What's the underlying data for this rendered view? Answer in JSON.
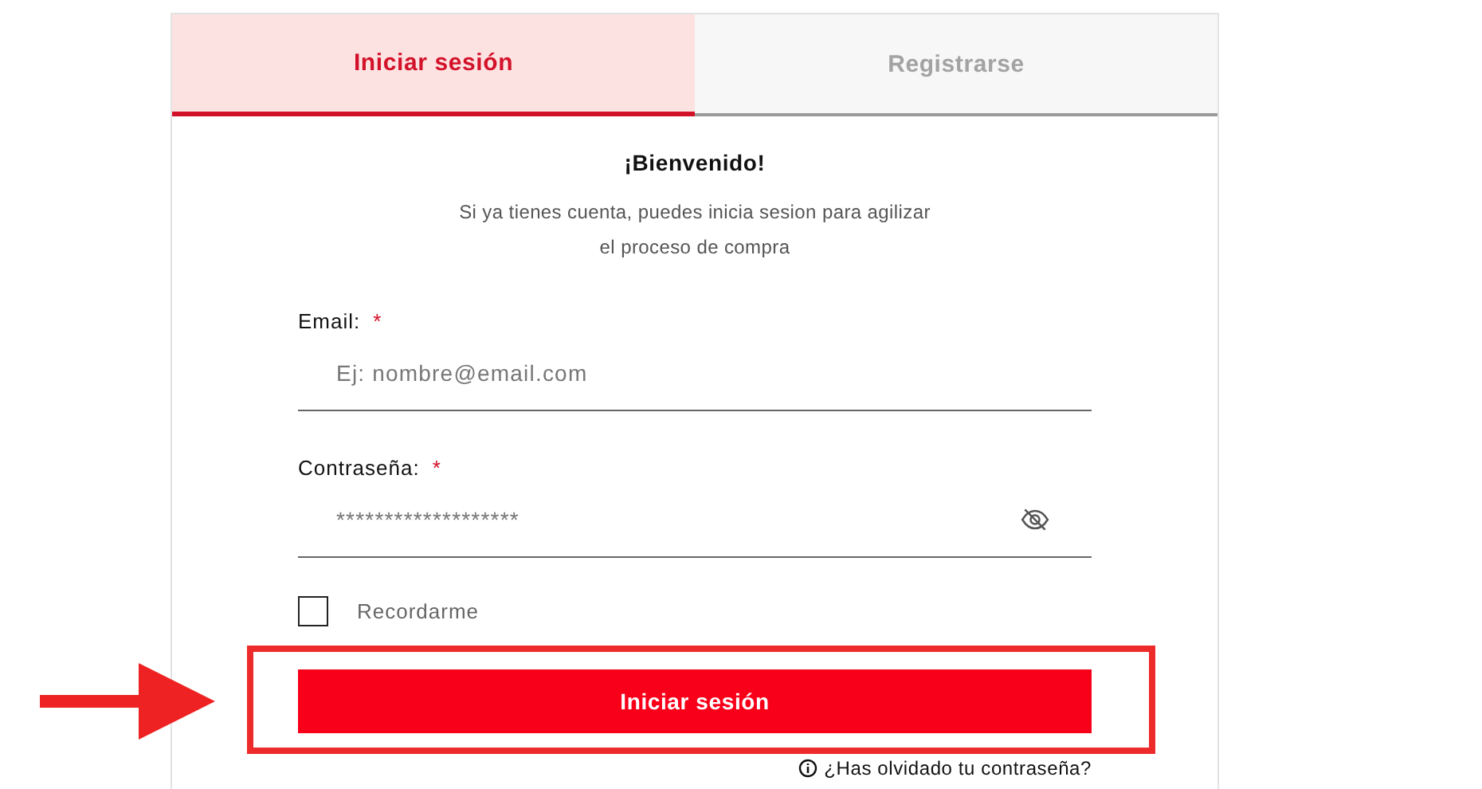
{
  "tabs": [
    {
      "label": "Iniciar sesión",
      "selected": true
    },
    {
      "label": "Registrarse",
      "selected": false
    }
  ],
  "welcome": {
    "title": "¡Bienvenido!",
    "description": "Si ya tienes cuenta, puedes inicia sesion para agilizar el proceso de compra"
  },
  "fields": [
    {
      "kind": "text",
      "label": "Email:",
      "required_mark": "*",
      "placeholder": "Ej: nombre@email.com"
    },
    {
      "kind": "password",
      "label": "Contraseña:",
      "required_mark": "*",
      "value": "*******************"
    }
  ],
  "remember": {
    "label": "Recordarme",
    "checked": false
  },
  "submit": {
    "label": "Iniciar sesión"
  },
  "forgot": {
    "label": "¿Has olvidado tu contraseña?"
  },
  "annotation": {
    "highlight": true,
    "arrow": true
  }
}
